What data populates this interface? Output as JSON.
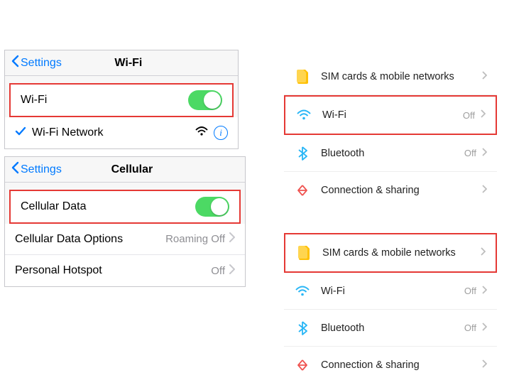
{
  "ios_wifi": {
    "back_label": "Settings",
    "title": "Wi-Fi",
    "toggle_row_label": "Wi-Fi",
    "network_row_label": "Wi-Fi Network"
  },
  "ios_cell": {
    "back_label": "Settings",
    "title": "Cellular",
    "cell_data_label": "Cellular Data",
    "options_label": "Cellular Data Options",
    "options_value": "Roaming Off",
    "hotspot_label": "Personal Hotspot",
    "hotspot_value": "Off"
  },
  "android1": {
    "sim_label": "SIM cards & mobile networks",
    "wifi_label": "Wi-Fi",
    "wifi_value": "Off",
    "bt_label": "Bluetooth",
    "bt_value": "Off",
    "conn_label": "Connection & sharing"
  },
  "android2": {
    "sim_label": "SIM cards & mobile networks",
    "wifi_label": "Wi-Fi",
    "wifi_value": "Off",
    "bt_label": "Bluetooth",
    "bt_value": "Off",
    "conn_label": "Connection & sharing"
  }
}
